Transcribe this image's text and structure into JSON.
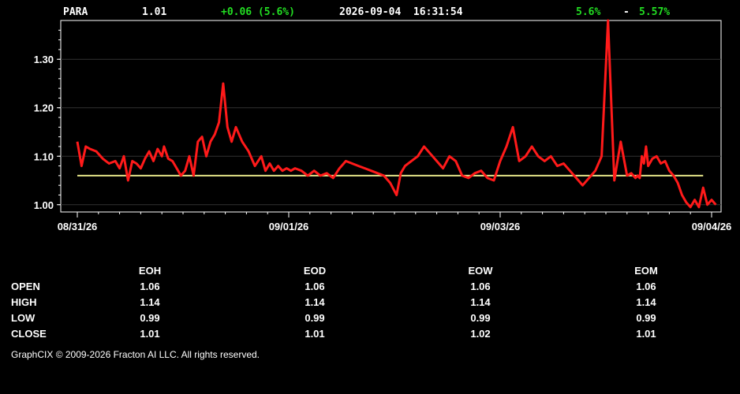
{
  "header": {
    "symbol": "PARA",
    "price": "1.01",
    "change": "+0.06 (5.6%)",
    "datetime": "2026-09-04  16:31:54",
    "pct_a": "5.6%",
    "sep": "-",
    "pct_b": "5.57%"
  },
  "colors": {
    "series": "#ff1a1a",
    "reference": "#e6e68a",
    "positive": "#22dd22",
    "grid": "#333333"
  },
  "chart_data": {
    "type": "line",
    "title": "",
    "xlabel": "",
    "ylabel": "",
    "ylim": [
      0.985,
      1.38
    ],
    "yticks": [
      1.0,
      1.1,
      1.2,
      1.3
    ],
    "ytick_labels": [
      "1.00",
      "1.10",
      "1.20",
      "1.30"
    ],
    "xlim": [
      0,
      30.2
    ],
    "xticks": [
      0,
      10,
      20,
      30
    ],
    "xtick_labels": [
      "08/31/26",
      "09/01/26",
      "09/03/26",
      "09/04/26"
    ],
    "grid": true,
    "reference_line": {
      "name": "",
      "value": 1.06
    },
    "series": [
      {
        "name": "",
        "x": [
          0,
          0.2,
          0.4,
          0.6,
          0.9,
          1.2,
          1.5,
          1.8,
          2.0,
          2.2,
          2.4,
          2.6,
          2.8,
          3.0,
          3.2,
          3.4,
          3.6,
          3.8,
          4.0,
          4.1,
          4.3,
          4.5,
          4.7,
          4.9,
          5.1,
          5.3,
          5.5,
          5.7,
          5.9,
          6.1,
          6.3,
          6.5,
          6.7,
          6.9,
          7.1,
          7.3,
          7.5,
          7.8,
          8.1,
          8.4,
          8.7,
          8.9,
          9.1,
          9.3,
          9.5,
          9.7,
          9.9,
          10.1,
          10.3,
          10.6,
          10.9,
          11.2,
          11.5,
          11.8,
          12.1,
          12.4,
          12.7,
          13.0,
          13.3,
          13.6,
          13.9,
          14.2,
          14.5,
          14.8,
          15.1,
          15.3,
          15.5,
          15.8,
          16.1,
          16.4,
          16.7,
          17.0,
          17.3,
          17.6,
          17.9,
          18.2,
          18.5,
          18.8,
          19.1,
          19.4,
          19.7,
          20.0,
          20.3,
          20.6,
          20.9,
          21.2,
          21.5,
          21.8,
          22.1,
          22.4,
          22.7,
          23.0,
          23.3,
          23.6,
          23.9,
          24.2,
          24.5,
          24.8,
          25.1,
          25.4,
          25.7,
          26.0,
          26.2,
          26.4,
          26.5,
          26.6,
          26.7,
          26.8,
          26.9,
          27.0,
          27.2,
          27.4,
          27.6,
          27.8,
          28.0,
          28.2,
          28.4,
          28.6,
          28.8,
          29.0,
          29.2,
          29.4,
          29.6,
          29.8,
          30.0,
          30.2
        ],
        "y": [
          1.13,
          1.08,
          1.12,
          1.115,
          1.11,
          1.095,
          1.085,
          1.09,
          1.075,
          1.1,
          1.05,
          1.09,
          1.085,
          1.075,
          1.095,
          1.11,
          1.09,
          1.115,
          1.1,
          1.12,
          1.095,
          1.09,
          1.075,
          1.06,
          1.07,
          1.1,
          1.06,
          1.13,
          1.14,
          1.1,
          1.13,
          1.145,
          1.17,
          1.25,
          1.16,
          1.13,
          1.16,
          1.13,
          1.11,
          1.08,
          1.1,
          1.07,
          1.085,
          1.07,
          1.08,
          1.07,
          1.075,
          1.07,
          1.075,
          1.07,
          1.06,
          1.07,
          1.06,
          1.065,
          1.055,
          1.075,
          1.09,
          1.085,
          1.08,
          1.075,
          1.07,
          1.065,
          1.06,
          1.045,
          1.02,
          1.065,
          1.08,
          1.09,
          1.1,
          1.12,
          1.105,
          1.09,
          1.075,
          1.1,
          1.09,
          1.06,
          1.055,
          1.065,
          1.07,
          1.055,
          1.05,
          1.09,
          1.12,
          1.16,
          1.09,
          1.1,
          1.12,
          1.1,
          1.09,
          1.1,
          1.08,
          1.085,
          1.07,
          1.055,
          1.04,
          1.055,
          1.07,
          1.1,
          1.38,
          1.05,
          1.13,
          1.06,
          1.065,
          1.055,
          1.06,
          1.055,
          1.1,
          1.085,
          1.12,
          1.08,
          1.095,
          1.1,
          1.085,
          1.09,
          1.07,
          1.06,
          1.045,
          1.02,
          1.005,
          0.995,
          1.01,
          0.995,
          1.035,
          1.0,
          1.01,
          1.0
        ]
      }
    ]
  },
  "table": {
    "columns": [
      "EOH",
      "EOD",
      "EOW",
      "EOM"
    ],
    "rows": [
      {
        "label": "OPEN",
        "values": [
          "1.06",
          "1.06",
          "1.06",
          "1.06"
        ]
      },
      {
        "label": "HIGH",
        "values": [
          "1.14",
          "1.14",
          "1.14",
          "1.14"
        ]
      },
      {
        "label": "LOW",
        "values": [
          "0.99",
          "0.99",
          "0.99",
          "0.99"
        ]
      },
      {
        "label": "CLOSE",
        "values": [
          "1.01",
          "1.01",
          "1.02",
          "1.01"
        ]
      }
    ]
  },
  "footer": "GraphCIX © 2009-2026 Fracton AI LLC. All rights reserved."
}
